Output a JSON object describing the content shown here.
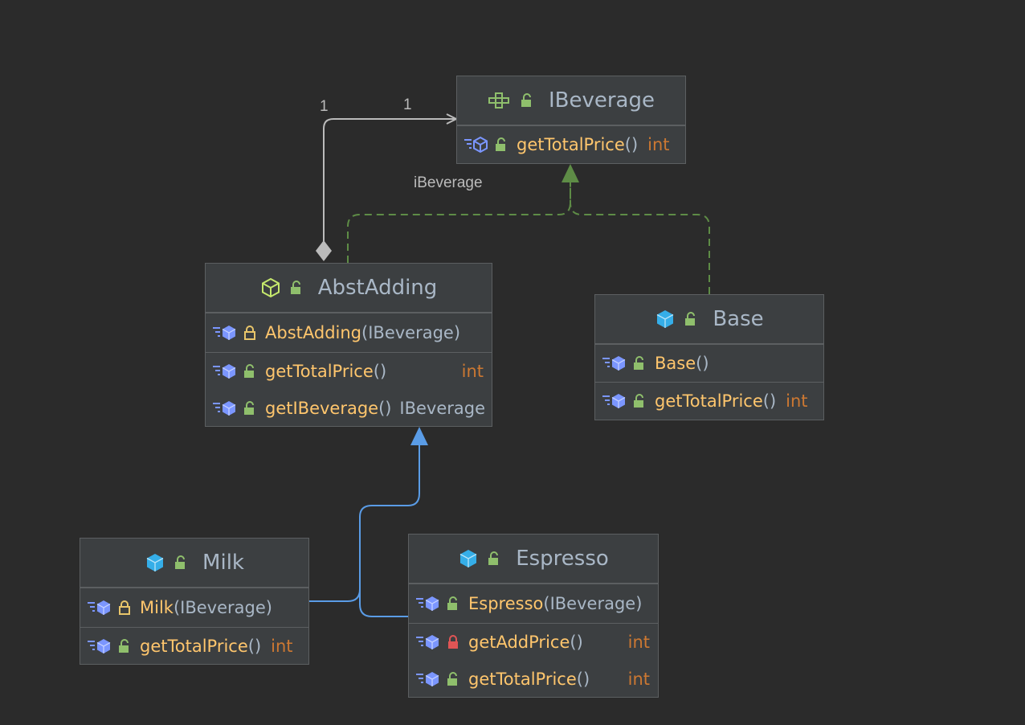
{
  "colors": {
    "background": "#2b2b2b",
    "node_fill": "#3c3f41",
    "node_border": "#5c5f61",
    "class_name": "#a9b7c6",
    "method_name": "#ffc66d",
    "return_type": "#cc7832",
    "realization_edge": "#5e8c46",
    "extends_edge": "#5a9ce6",
    "association_edge": "#bbbbbb",
    "public_lock": "#8fbf6c",
    "protected_lock": "#e8c56a",
    "private_lock": "#e05555"
  },
  "edge_labels": {
    "source_multiplicity": "1",
    "target_multiplicity": "1",
    "role": "iBeverage"
  },
  "classes": {
    "ibeverage": {
      "name": "IBeverage",
      "kind_icon": "interface-icon",
      "methods": [
        {
          "name": "getTotalPrice",
          "parens": "()",
          "params": "",
          "return_type": "int",
          "visibility_icon": "public-lock-icon",
          "member_icon": "abstract-method-icon"
        }
      ]
    },
    "abstadding": {
      "name": "AbstAdding",
      "kind_icon": "abstract-class-icon",
      "constructors": [
        {
          "name": "AbstAdding",
          "params": "IBeverage",
          "visibility_icon": "protected-lock-icon",
          "member_icon": "method-icon"
        }
      ],
      "methods": [
        {
          "name": "getTotalPrice",
          "parens": "()",
          "return_type": "int",
          "visibility_icon": "public-lock-icon",
          "member_icon": "method-icon"
        },
        {
          "name": "getIBeverage",
          "parens": "()",
          "return_type": "IBeverage",
          "visibility_icon": "public-lock-icon",
          "member_icon": "method-icon"
        }
      ]
    },
    "base": {
      "name": "Base",
      "kind_icon": "class-icon",
      "constructors": [
        {
          "name": "Base",
          "parens": "()",
          "visibility_icon": "public-lock-icon",
          "member_icon": "method-icon"
        }
      ],
      "methods": [
        {
          "name": "getTotalPrice",
          "parens": "()",
          "return_type": "int",
          "visibility_icon": "public-lock-icon",
          "member_icon": "method-icon"
        }
      ]
    },
    "milk": {
      "name": "Milk",
      "kind_icon": "class-icon",
      "constructors": [
        {
          "name": "Milk",
          "params": "IBeverage",
          "visibility_icon": "protected-lock-icon",
          "member_icon": "method-icon"
        }
      ],
      "methods": [
        {
          "name": "getTotalPrice",
          "parens": "()",
          "return_type": "int",
          "visibility_icon": "public-lock-icon",
          "member_icon": "method-icon"
        }
      ]
    },
    "espresso": {
      "name": "Espresso",
      "kind_icon": "class-icon",
      "constructors": [
        {
          "name": "Espresso",
          "params": "IBeverage",
          "visibility_icon": "public-lock-icon",
          "member_icon": "method-icon"
        }
      ],
      "methods": [
        {
          "name": "getAddPrice",
          "parens": "()",
          "return_type": "int",
          "visibility_icon": "private-lock-icon",
          "member_icon": "method-icon"
        },
        {
          "name": "getTotalPrice",
          "parens": "()",
          "return_type": "int",
          "visibility_icon": "public-lock-icon",
          "member_icon": "method-icon"
        }
      ]
    }
  }
}
